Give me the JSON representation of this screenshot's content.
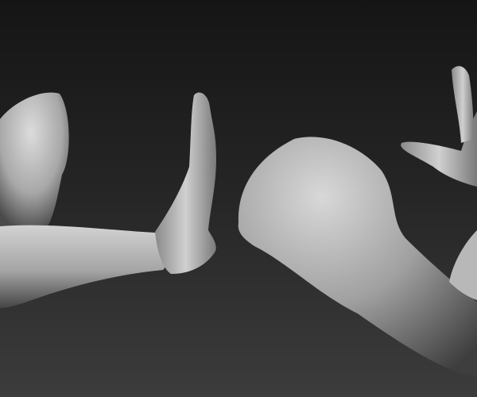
{
  "scene": {
    "subject": "sculpted arms",
    "colors": {
      "background_top": "#151515",
      "background_bottom": "#3c3c3c",
      "clay_light": "#d6d6d6",
      "clay_mid": "#9a9a9a",
      "clay_dark": "#3a3a3a"
    }
  }
}
